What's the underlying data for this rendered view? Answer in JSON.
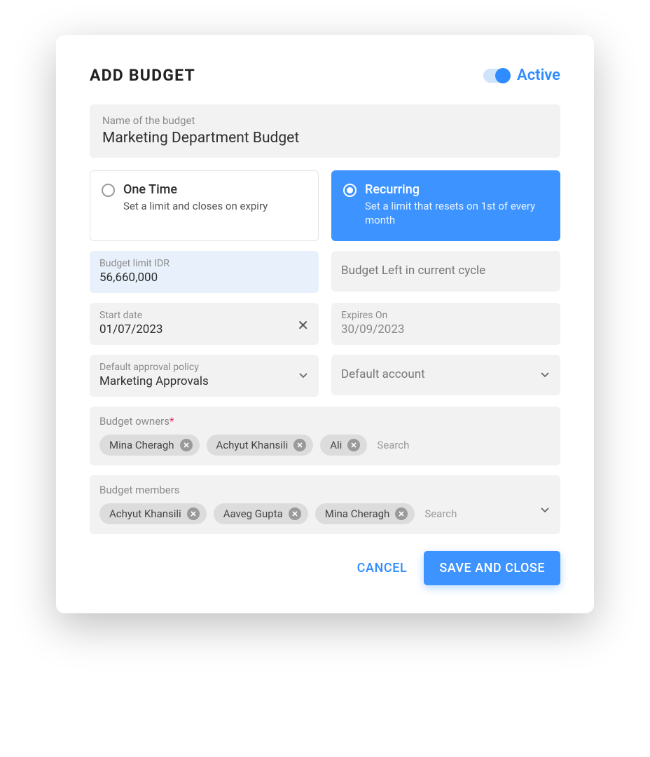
{
  "title": "ADD BUDGET",
  "status": {
    "label": "Active",
    "on": true
  },
  "name_field": {
    "label": "Name of the budget",
    "value": "Marketing Department Budget"
  },
  "type_options": {
    "one_time": {
      "title": "One Time",
      "sub": "Set a limit and closes on expiry"
    },
    "recurring": {
      "title": "Recurring",
      "sub": "Set a limit that resets on 1st of every month"
    }
  },
  "limit": {
    "label": "Budget limit IDR",
    "value": "56,660,000"
  },
  "budget_left": {
    "placeholder": "Budget Left in current cycle"
  },
  "start": {
    "label": "Start date",
    "value": "01/07/2023"
  },
  "expires": {
    "label": "Expires On",
    "value": "30/09/2023"
  },
  "approval": {
    "label": "Default approval policy",
    "value": "Marketing Approvals"
  },
  "account": {
    "placeholder": "Default account"
  },
  "owners": {
    "label": "Budget owners",
    "chips": [
      "Mina Cheragh",
      "Achyut Khansili",
      "Ali"
    ],
    "search": "Search"
  },
  "members": {
    "label": "Budget members",
    "chips": [
      "Achyut Khansili",
      "Aaveg Gupta",
      "Mina Cheragh"
    ],
    "search": "Search"
  },
  "buttons": {
    "cancel": "CANCEL",
    "save": "SAVE AND CLOSE"
  }
}
